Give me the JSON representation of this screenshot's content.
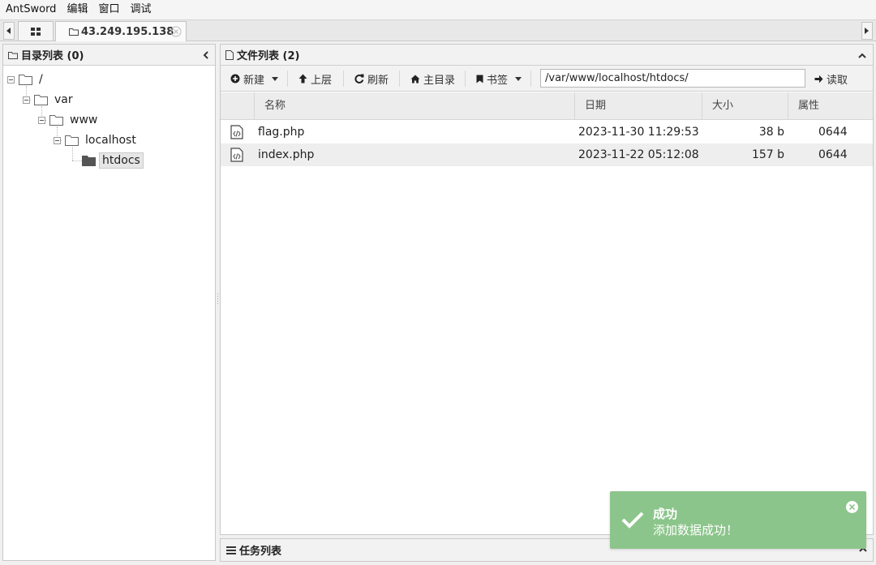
{
  "menubar": {
    "items": [
      "AntSword",
      "编辑",
      "窗口",
      "调试"
    ]
  },
  "tabs": {
    "host_tab_label": "43.249.195.138"
  },
  "dir_panel": {
    "title": "目录列表 (0)",
    "tree": {
      "root": "/",
      "var": "var",
      "www": "www",
      "localhost": "localhost",
      "htdocs": "htdocs"
    }
  },
  "file_panel": {
    "title": "文件列表 (2)",
    "toolbar": {
      "new_label": "新建",
      "up_label": "上层",
      "refresh_label": "刷新",
      "home_label": "主目录",
      "bookmark_label": "书签",
      "path_value": "/var/www/localhost/htdocs/",
      "read_label": "读取"
    },
    "columns": {
      "name": "名称",
      "date": "日期",
      "size": "大小",
      "perm": "属性"
    },
    "rows": [
      {
        "name": "flag.php",
        "date": "2023-11-30 11:29:53",
        "size": "38 b",
        "perm": "0644"
      },
      {
        "name": "index.php",
        "date": "2023-11-22 05:12:08",
        "size": "157 b",
        "perm": "0644"
      }
    ]
  },
  "task_panel": {
    "title": "任务列表"
  },
  "toast": {
    "title": "成功",
    "message": "添加数据成功！",
    "color": "#8cc58b"
  }
}
